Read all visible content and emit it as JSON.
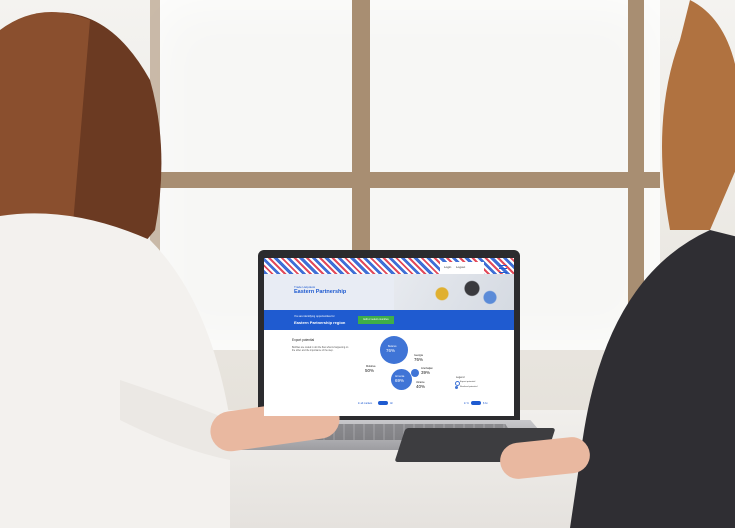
{
  "screen": {
    "header": {
      "link1": "Login",
      "link2": "Logout"
    },
    "hero": {
      "pretitle": "Trade Helpdesk",
      "title": "Eastern Partnership"
    },
    "band": {
      "small": "You are identifying opportunities for",
      "big": "Eastern Partnership region",
      "button": "Edit or select countries"
    },
    "section": {
      "title": "Export potential",
      "text": "Bubbles are coded in dot the flow what is happening on the other and the importance of the step."
    },
    "bubbles": [
      {
        "label": "Belarus",
        "value": "76%"
      },
      {
        "label": "Moldova",
        "value": "50%"
      },
      {
        "label": "Georgia",
        "value": "76%"
      },
      {
        "label": "Azerbaijan",
        "value": "39%"
      },
      {
        "label": "Armenia",
        "value": "69%"
      },
      {
        "label": "Ukraine",
        "value": "40%"
      }
    ],
    "legend": {
      "title": "Legend",
      "items": [
        "Export potential",
        "Realised potential"
      ]
    },
    "toggles": {
      "left": "In all markets",
      "left_value": "All",
      "right_a": "In %",
      "right_b": "$ bn"
    }
  },
  "colors": {
    "brand_blue": "#1f5bd0",
    "bubble_blue": "#3f74d6",
    "green": "#3fae49"
  }
}
